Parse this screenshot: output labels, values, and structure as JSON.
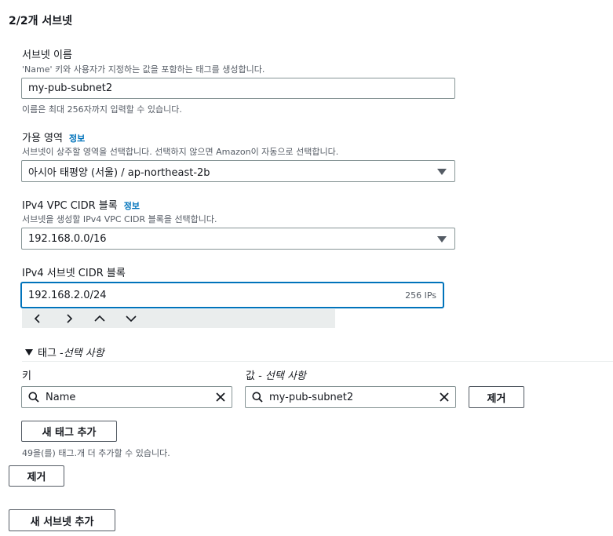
{
  "header": {
    "title": "2/2개 서브넷"
  },
  "subnet_name": {
    "label": "서브넷 이름",
    "description": "'Name' 키와 사용자가 지정하는 값을 포함하는 태그를 생성합니다.",
    "value": "my-pub-subnet2",
    "hint": "이름은 최대 256자까지 입력할 수 있습니다."
  },
  "availability_zone": {
    "label": "가용 영역",
    "info": "정보",
    "description": "서브넷이 상주할 영역을 선택합니다. 선택하지 않으면 Amazon이 자동으로 선택합니다.",
    "value": "아시아 태평양 (서울) / ap-northeast-2b"
  },
  "vpc_cidr": {
    "label": "IPv4 VPC CIDR 블록",
    "info": "정보",
    "description": "서브넷을 생성할 IPv4 VPC CIDR 블록을 선택합니다.",
    "value": "192.168.0.0/16"
  },
  "subnet_cidr": {
    "label": "IPv4 서브넷 CIDR 블록",
    "value": "192.168.2.0/24",
    "ip_count": "256 IPs"
  },
  "tags": {
    "section_label": "태그 - ",
    "section_label_italic": "선택 사항",
    "key_label": "키",
    "value_label": "값 - ",
    "value_label_italic": "선택 사항",
    "key_value": "Name",
    "value_value": "my-pub-subnet2",
    "remove_label": "제거",
    "add_tag_label": "새 태그 추가",
    "remaining_hint": "49을(를) 태그.개 더 추가할 수 있습니다."
  },
  "actions": {
    "remove_subnet_label": "제거",
    "add_subnet_label": "새 서브넷 추가"
  },
  "colors": {
    "accent": "#0073bb",
    "border": "#879596",
    "muted_text": "#545b64",
    "stepper_bg": "#eaeded"
  },
  "icons": [
    "chevron-left-icon",
    "chevron-right-icon",
    "chevron-up-icon",
    "chevron-down-icon",
    "search-icon",
    "clear-icon",
    "caret-down-icon"
  ]
}
